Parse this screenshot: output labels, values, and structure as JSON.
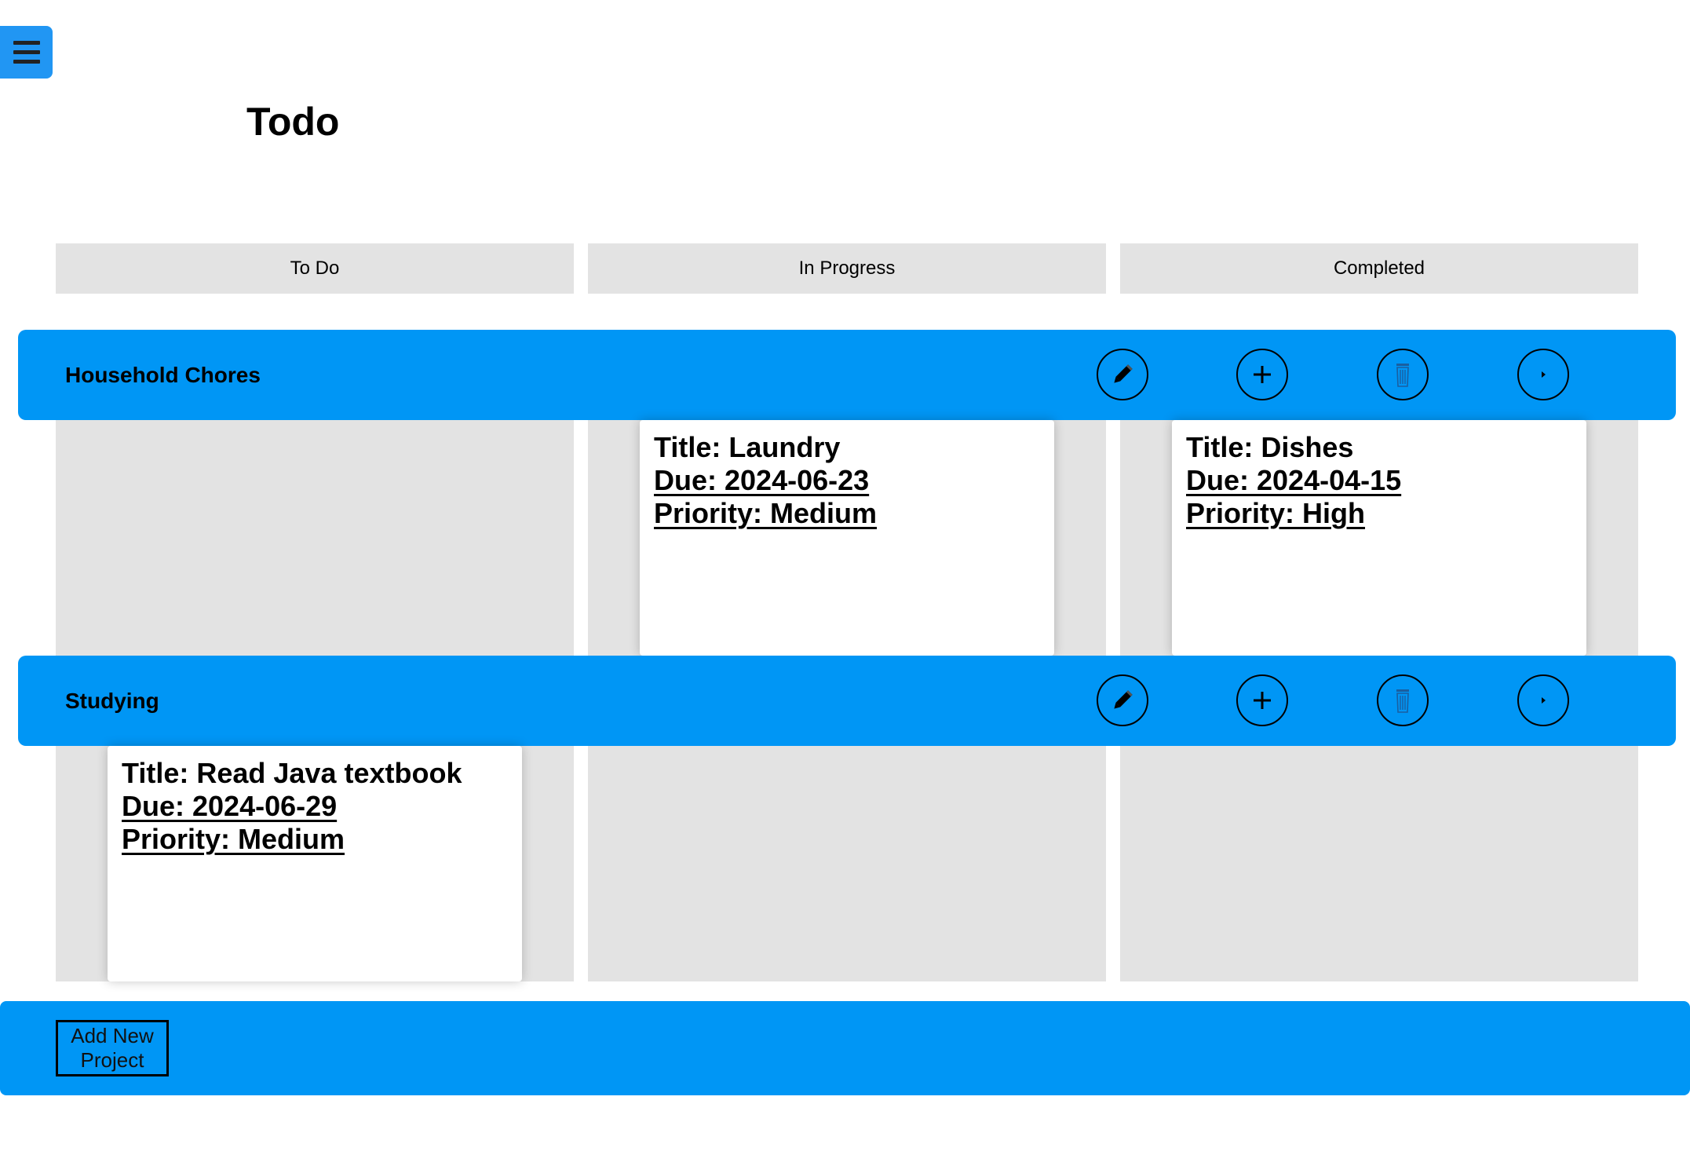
{
  "app": {
    "title": "Todo"
  },
  "columns": [
    "To Do",
    "In Progress",
    "Completed"
  ],
  "colors": {
    "accent": "#0096f5",
    "column_bg": "#e3e3e3",
    "priority_high": "#e01010",
    "priority_medium": "#d4c800"
  },
  "project_actions": [
    "pencil-icon",
    "plus-icon",
    "trash-icon",
    "chevron-right-icon"
  ],
  "projects": [
    {
      "name": "Household Chores",
      "todos": {
        "in_progress": {
          "title": "Title: Laundry",
          "due": "Due: 2024-06-23",
          "priority": "Priority: Medium"
        },
        "completed": {
          "title": "Title: Dishes",
          "due": "Due: 2024-04-15",
          "priority": "Priority: High"
        }
      }
    },
    {
      "name": "Studying",
      "todos": {
        "todo": {
          "title": "Title: Read Java textbook",
          "due": "Due: 2024-06-29",
          "priority": "Priority: Medium"
        }
      }
    }
  ],
  "footer": {
    "add_project_label": "Add New Project"
  }
}
